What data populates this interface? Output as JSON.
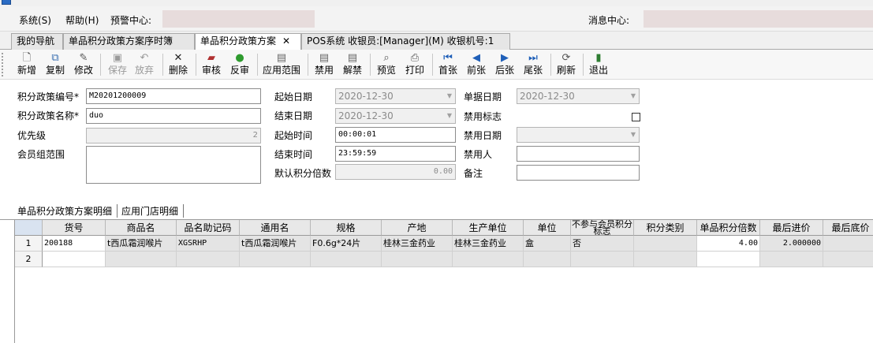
{
  "menu": {
    "system": "系统(S)",
    "help": "帮助(H)",
    "alert": "预警中心:",
    "message": "消息中心:"
  },
  "tabs": [
    {
      "label": "我的导航"
    },
    {
      "label": "单品积分政策方案序时簿"
    },
    {
      "label": "单品积分政策方案",
      "close": "✕"
    },
    {
      "label": "POS系统 收银员:[Manager](M) 收银机号:1"
    }
  ],
  "toolbar": [
    {
      "label": "新增",
      "icon": "new-doc-icon"
    },
    {
      "label": "复制",
      "icon": "copy-icon"
    },
    {
      "label": "修改",
      "icon": "edit-icon"
    },
    {
      "label": "保存",
      "icon": "save-icon"
    },
    {
      "label": "放弃",
      "icon": "undo-icon"
    },
    {
      "label": "删除",
      "icon": "delete-x-icon"
    },
    {
      "label": "审核",
      "icon": "audit-icon"
    },
    {
      "label": "反审",
      "icon": "green-circle-icon"
    },
    {
      "label": "应用范围",
      "icon": "scope-icon"
    },
    {
      "label": "禁用",
      "icon": "disable-icon"
    },
    {
      "label": "解禁",
      "icon": "enable-icon"
    },
    {
      "label": "预览",
      "icon": "preview-icon"
    },
    {
      "label": "打印",
      "icon": "print-icon"
    },
    {
      "label": "首张",
      "icon": "first-icon"
    },
    {
      "label": "前张",
      "icon": "prev-icon"
    },
    {
      "label": "后张",
      "icon": "next-icon"
    },
    {
      "label": "尾张",
      "icon": "last-icon"
    },
    {
      "label": "刷新",
      "icon": "refresh-icon"
    },
    {
      "label": "退出",
      "icon": "exit-icon"
    }
  ],
  "form": {
    "code_label": "积分政策编号*",
    "code_value": "M20201200009",
    "name_label": "积分政策名称*",
    "name_value": "duo",
    "priority_label": "优先级",
    "priority_value": "2",
    "member_label": "会员组范围",
    "start_date_label": "起始日期",
    "start_date_value": "2020-12-30",
    "end_date_label": "结束日期",
    "end_date_value": "2020-12-30",
    "start_time_label": "起始时间",
    "start_time_value": "00:00:01",
    "end_time_label": "结束时间",
    "end_time_value": "23:59:59",
    "multiple_label": "默认积分倍数",
    "multiple_value": "0.00",
    "doc_date_label": "单据日期",
    "doc_date_value": "2020-12-30",
    "disable_flag_label": "禁用标志",
    "disable_date_label": "禁用日期",
    "disable_user_label": "禁用人",
    "remark_label": "备注"
  },
  "subtabs": {
    "detail": "单品积分政策方案明细",
    "store": "应用门店明细"
  },
  "grid": {
    "headers": [
      "货号",
      "商品名",
      "品名助记码",
      "通用名",
      "规格",
      "产地",
      "生产单位",
      "单位",
      "不参与会员积分标志",
      "积分类别",
      "单品积分倍数",
      "最后进价",
      "最后底价"
    ],
    "rows": [
      {
        "no": "1",
        "cells": [
          "200188",
          "t西瓜霜润喉片",
          "XGSRHP",
          "t西瓜霜润喉片",
          "F0.6g*24片",
          "桂林三金药业",
          "桂林三金药业",
          "盒",
          "否",
          "",
          "4.00",
          "2.000000",
          ""
        ]
      },
      {
        "no": "2",
        "cells": [
          "",
          "",
          "",
          "",
          "",
          "",
          "",
          "",
          "",
          "",
          "",
          "",
          ""
        ]
      }
    ]
  }
}
